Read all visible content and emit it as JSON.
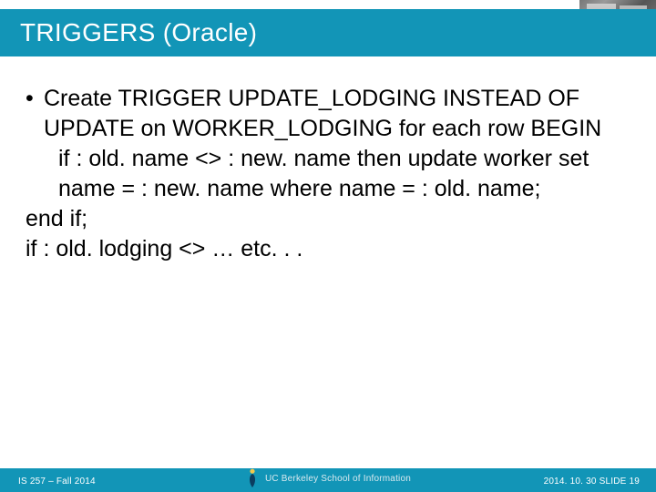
{
  "title": "TRIGGERS (Oracle)",
  "body": {
    "line1": "Create TRIGGER UPDATE_LODGING INSTEAD OF UPDATE on WORKER_LODGING for each row BEGIN",
    "line2": "if : old. name <> : new. name then update worker set name = : new. name where name = : old. name;",
    "line3": " end if;",
    "line4": "if : old. lodging <> … etc. . ."
  },
  "footer": {
    "left": "IS 257 – Fall 2014",
    "org": "UC Berkeley School of Information",
    "right": "2014. 10. 30 SLIDE 19"
  }
}
